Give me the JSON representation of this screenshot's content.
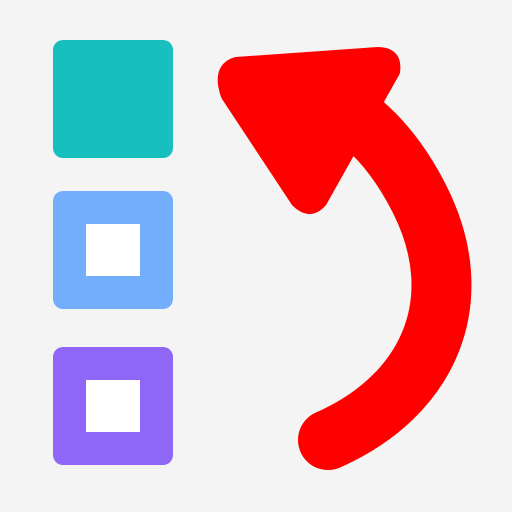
{
  "icon": {
    "name": "move-up-list-icon",
    "background_color": "#f4f4f4",
    "items": [
      {
        "name": "filled-square",
        "color": "#17bfbf",
        "state": "filled"
      },
      {
        "name": "hollow-square",
        "color": "#72aefb",
        "state": "hollow"
      },
      {
        "name": "hollow-square",
        "color": "#8f67f7",
        "state": "hollow"
      }
    ],
    "arrow": {
      "name": "curved-up-arrow-icon",
      "color": "#ff0000",
      "direction": "up-left"
    }
  }
}
